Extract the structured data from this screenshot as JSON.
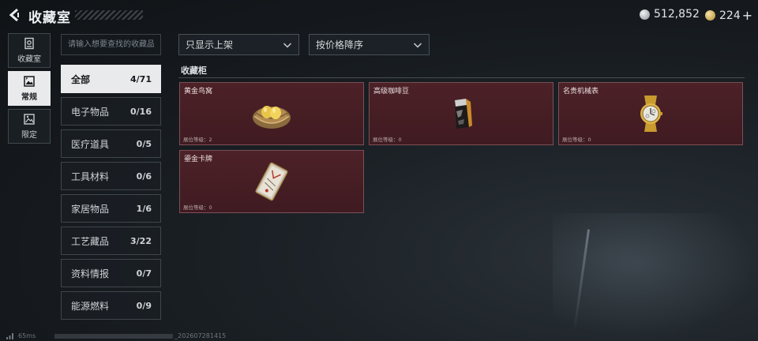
{
  "header": {
    "title": "收藏室",
    "currency_silver": "512,852",
    "currency_gold": "224",
    "plus": "+"
  },
  "left_nav": [
    {
      "label": "收藏室",
      "icon": "collection-room-icon",
      "active": false
    },
    {
      "label": "常规",
      "icon": "regular-icon",
      "active": true
    },
    {
      "label": "限定",
      "icon": "limited-icon",
      "active": false
    }
  ],
  "search": {
    "placeholder": "请输入想要查找的收藏品"
  },
  "filters": {
    "shelf_filter": "只显示上架",
    "sort": "按价格降序"
  },
  "categories": [
    {
      "label": "全部",
      "count": "4/71",
      "active": true
    },
    {
      "label": "电子物品",
      "count": "0/16"
    },
    {
      "label": "医疗道具",
      "count": "0/5"
    },
    {
      "label": "工具材料",
      "count": "0/6"
    },
    {
      "label": "家居物品",
      "count": "1/6"
    },
    {
      "label": "工艺藏品",
      "count": "3/22"
    },
    {
      "label": "资料情报",
      "count": "0/7"
    },
    {
      "label": "能源燃料",
      "count": "0/9"
    }
  ],
  "cabinet": {
    "title": "收藏柜",
    "items": [
      {
        "name": "黄金鸟窝",
        "level_text": "展位等级：2",
        "icon": "golden-bird-nest-icon"
      },
      {
        "name": "高级咖啡豆",
        "level_text": "展位等级：0",
        "icon": "coffee-bean-bag-icon"
      },
      {
        "name": "名贵机械表",
        "level_text": "展位等级：0",
        "icon": "luxury-watch-icon"
      },
      {
        "name": "鎏金卡牌",
        "level_text": "展位等级：0",
        "icon": "gilded-card-icon"
      }
    ]
  },
  "footer": {
    "ping": "65ms",
    "build_suffix": "_202607281415"
  }
}
